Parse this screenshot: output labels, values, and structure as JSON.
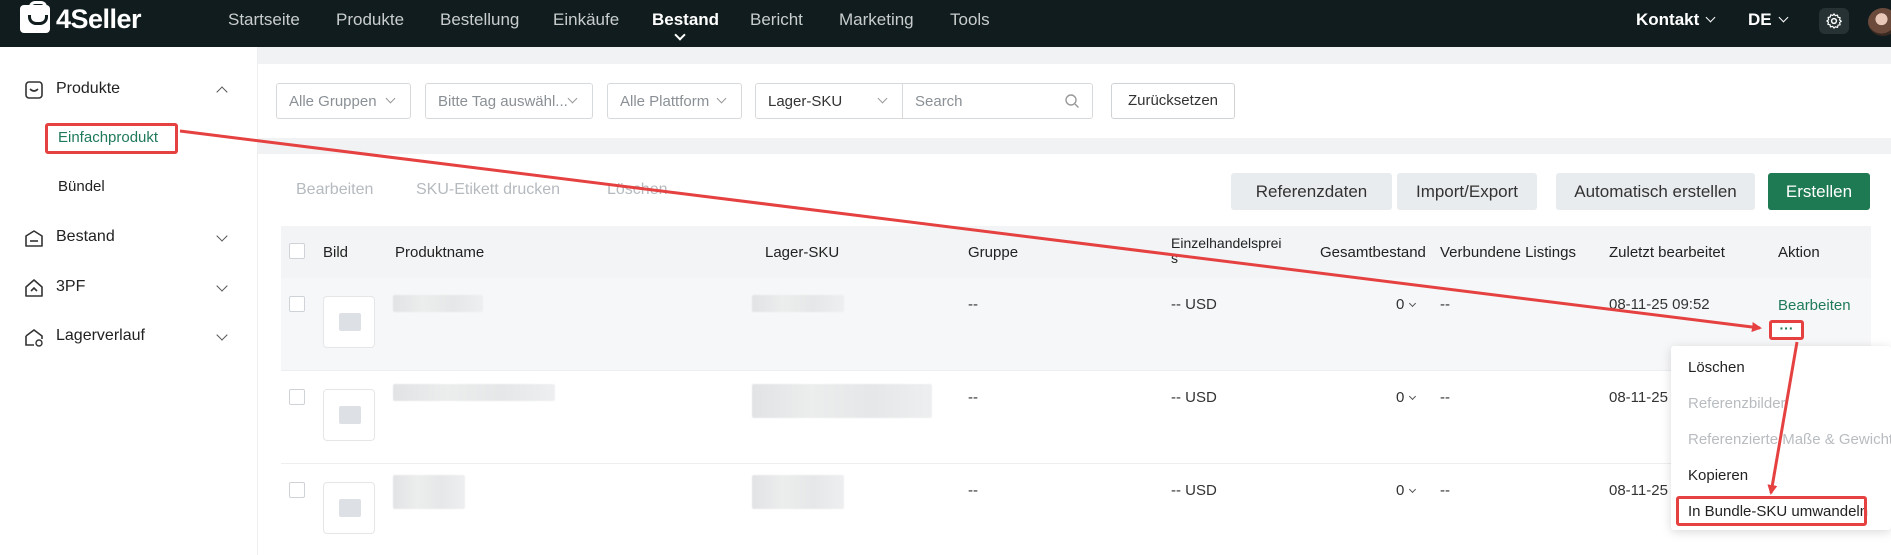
{
  "app": {
    "logo_text": "4Seller"
  },
  "topnav": {
    "items": [
      {
        "label": "Startseite"
      },
      {
        "label": "Produkte"
      },
      {
        "label": "Bestellung"
      },
      {
        "label": "Einkäufe"
      },
      {
        "label": "Bestand"
      },
      {
        "label": "Bericht"
      },
      {
        "label": "Marketing"
      },
      {
        "label": "Tools"
      }
    ],
    "active": "Bestand",
    "contact": "Kontakt",
    "language": "DE"
  },
  "sidebar": {
    "groups": [
      {
        "label": "Produkte",
        "icon": "box-icon",
        "expanded": true,
        "children": [
          {
            "label": "Einfachprodukt"
          },
          {
            "label": "Bündel"
          }
        ]
      },
      {
        "label": "Bestand",
        "icon": "warehouse-icon"
      },
      {
        "label": "3PF",
        "icon": "house-icon"
      },
      {
        "label": "Lagerverlauf",
        "icon": "history-icon"
      }
    ]
  },
  "filters": {
    "group": "Alle Gruppen",
    "tag": "Bitte Tag auswähl...",
    "platform": "Alle Plattform",
    "sku_type": "Lager-SKU",
    "search_placeholder": "Search",
    "reset": "Zurücksetzen"
  },
  "actions": {
    "edit": "Bearbeiten",
    "print_label": "SKU-Etikett drucken",
    "delete": "Löschen",
    "reference_data": "Referenzdaten",
    "import_export": "Import/Export",
    "auto_create": "Automatisch erstellen",
    "create": "Erstellen"
  },
  "table": {
    "headers": {
      "image": "Bild",
      "name": "Produktname",
      "sku": "Lager-SKU",
      "group": "Gruppe",
      "price_line1": "Einzelhandelsprei",
      "price_line2": "s",
      "stock": "Gesamtbestand",
      "listings": "Verbundene Listings",
      "edited": "Zuletzt bearbeitet",
      "action": "Aktion"
    },
    "rows": [
      {
        "group": "--",
        "price": "-- USD",
        "stock": "0",
        "listings": "--",
        "edited": "08-11-25 09:52",
        "action": "Bearbeiten",
        "more": "···"
      },
      {
        "group": "--",
        "price": "-- USD",
        "stock": "0",
        "listings": "--",
        "edited": "08-11-25"
      },
      {
        "group": "--",
        "price": "-- USD",
        "stock": "0",
        "listings": "--",
        "edited": "08-11-25"
      }
    ]
  },
  "row_menu": {
    "items": [
      {
        "label": "Löschen",
        "enabled": true
      },
      {
        "label": "Referenzbilder",
        "enabled": false
      },
      {
        "label": "Referenzierte Maße & Gewicht",
        "enabled": false
      },
      {
        "label": "Kopieren",
        "enabled": true
      },
      {
        "label": "In Bundle-SKU umwandeln",
        "enabled": true
      }
    ]
  },
  "colors": {
    "topbar": "#101c1d",
    "brand_green": "#1d7a52",
    "annotation_red": "#e64141"
  }
}
